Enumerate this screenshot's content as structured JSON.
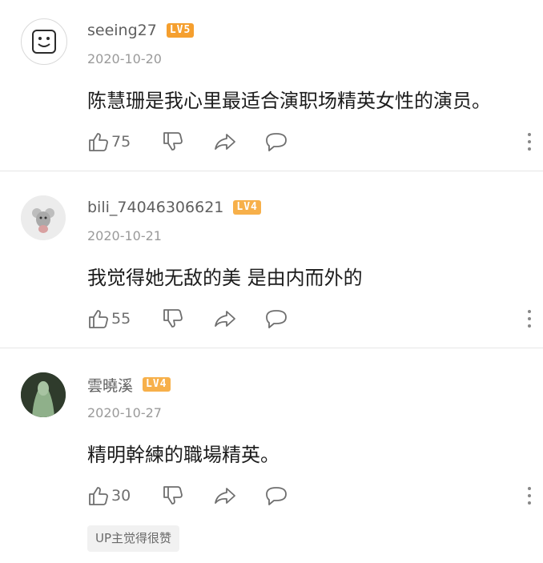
{
  "comments": [
    {
      "username": "seeing27",
      "level": "LV5",
      "date": "2020-10-20",
      "text": "陈慧珊是我心里最适合演职场精英女性的演员。",
      "likes": "75",
      "avatar_icon": "smiley-face-icon"
    },
    {
      "username": "bili_74046306621",
      "level": "LV4",
      "date": "2020-10-21",
      "text": "我觉得她无敌的美 是由内而外的",
      "likes": "55",
      "avatar_icon": "mouse-icon"
    },
    {
      "username": "雲曉溪",
      "level": "LV4",
      "date": "2020-10-27",
      "text": "精明幹練的職場精英。",
      "likes": "30",
      "avatar_icon": "photo-avatar-icon"
    }
  ],
  "up_badge": "UP主觉得很赞",
  "colors": {
    "level5": "#f59f2e",
    "level4": "#f7b04a",
    "text": "#1c1c1c",
    "secondary": "#9a9a9a"
  }
}
